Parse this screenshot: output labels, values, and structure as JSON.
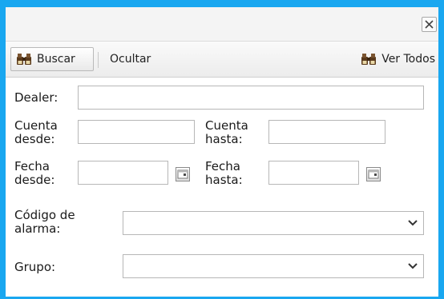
{
  "toolbar": {
    "buscar_label": "Buscar",
    "ocultar_label": "Ocultar",
    "ver_todos_label": "Ver Todos"
  },
  "form": {
    "dealer_label": "Dealer:",
    "cuenta_desde_label": "Cuenta\ndesde:",
    "cuenta_hasta_label": "Cuenta\nhasta:",
    "fecha_desde_label": "Fecha\ndesde:",
    "fecha_hasta_label": "Fecha\nhasta:",
    "codigo_alarma_label": "Código de\nalarma:",
    "grupo_label": "Grupo:",
    "dealer_value": "",
    "cuenta_desde_value": "",
    "cuenta_hasta_value": "",
    "fecha_desde_value": "",
    "fecha_hasta_value": "",
    "codigo_alarma_value": "",
    "grupo_value": ""
  },
  "icons": {
    "close": "close-icon",
    "binoculars": "binoculars-icon",
    "calendar": "calendar-icon",
    "dropdown": "chevron-down-icon"
  },
  "colors": {
    "window_border": "#19a7f0"
  }
}
